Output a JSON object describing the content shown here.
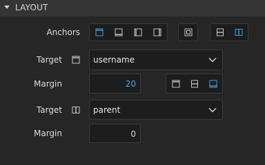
{
  "section": {
    "title": "LAYOUT",
    "collapse_icon": "triangle-down-icon"
  },
  "anchors": {
    "label": "Anchors",
    "group1": [
      {
        "icon": "anchor-top-icon",
        "active": true
      },
      {
        "icon": "anchor-bottom-icon",
        "active": false
      },
      {
        "icon": "anchor-left-icon",
        "active": false
      },
      {
        "icon": "anchor-right-icon",
        "active": false
      }
    ],
    "group2": [
      {
        "icon": "anchor-fill-icon",
        "active": false
      }
    ],
    "group3": [
      {
        "icon": "anchor-vertical-center-icon",
        "active": false
      },
      {
        "icon": "anchor-horizontal-center-icon",
        "active": true
      }
    ]
  },
  "target1": {
    "label": "Target",
    "icon": "anchor-top-icon",
    "value": "username"
  },
  "margin1": {
    "label": "Margin",
    "value": "20",
    "value_color": "#4ea6e0",
    "align_buttons": [
      {
        "icon": "align-top-icon",
        "active": false
      },
      {
        "icon": "align-center-icon",
        "active": false
      },
      {
        "icon": "align-bottom-icon",
        "active": true
      }
    ]
  },
  "target2": {
    "label": "Target",
    "icon": "anchor-horizontal-center-icon",
    "value": "parent"
  },
  "margin2": {
    "label": "Margin",
    "value": "0",
    "value_color": "#d4d4d4"
  },
  "colors": {
    "accent": "#3fa1e0",
    "icon": "#c8c8c8"
  }
}
